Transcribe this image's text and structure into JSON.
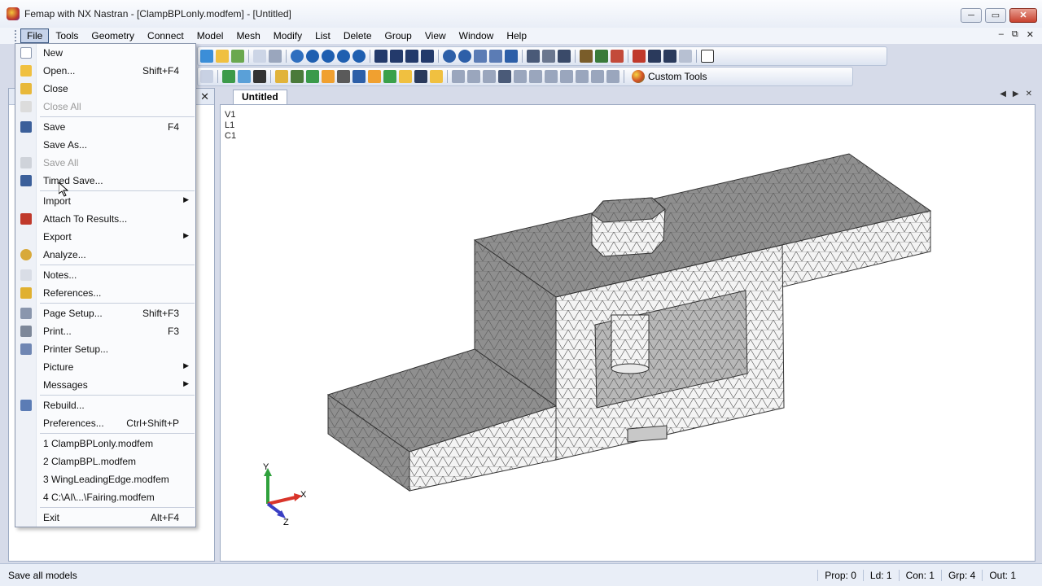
{
  "window": {
    "title": "Femap with NX Nastran - [ClampBPLonly.modfem] - [Untitled]",
    "minimize_label": "─",
    "maximize_label": "▭",
    "close_label": "✕"
  },
  "menubar": {
    "items": [
      "File",
      "Tools",
      "Geometry",
      "Connect",
      "Model",
      "Mesh",
      "Modify",
      "List",
      "Delete",
      "Group",
      "View",
      "Window",
      "Help"
    ],
    "mdi": [
      "–",
      "⧉",
      "✕"
    ]
  },
  "toolbar": {
    "custom_tools_label": "Custom Tools"
  },
  "left_pane": {
    "close_label": "✕"
  },
  "graphics": {
    "tab_label": "Untitled",
    "tab_nav": [
      "◀",
      "▶",
      "✕"
    ],
    "view_info": [
      "V1",
      "L1",
      "C1"
    ],
    "triad": {
      "x_label": "X",
      "y_label": "Y",
      "z_label": "Z"
    }
  },
  "file_menu": {
    "items": [
      {
        "label": "New",
        "shortcut": "",
        "icon": "new-icon",
        "disabled": false
      },
      {
        "label": "Open...",
        "shortcut": "Shift+F4",
        "icon": "open-icon",
        "disabled": false
      },
      {
        "label": "Close",
        "shortcut": "",
        "icon": "close-folder-icon",
        "disabled": false
      },
      {
        "label": "Close All",
        "shortcut": "",
        "icon": "close-all-icon",
        "disabled": true
      },
      {
        "label": "Save",
        "shortcut": "F4",
        "icon": "save-icon",
        "disabled": false
      },
      {
        "label": "Save As...",
        "shortcut": "",
        "icon": "",
        "disabled": false
      },
      {
        "label": "Save All",
        "shortcut": "",
        "icon": "save-all-icon",
        "disabled": true
      },
      {
        "label": "Timed Save...",
        "shortcut": "",
        "icon": "timed-save-icon",
        "disabled": false
      },
      {
        "label": "Import",
        "shortcut": "",
        "icon": "",
        "disabled": false,
        "submenu": true
      },
      {
        "label": "Attach To Results...",
        "shortcut": "",
        "icon": "attach-results-icon",
        "disabled": false
      },
      {
        "label": "Export",
        "shortcut": "",
        "icon": "",
        "disabled": false,
        "submenu": true
      },
      {
        "label": "Analyze...",
        "shortcut": "",
        "icon": "analyze-icon",
        "disabled": false
      },
      {
        "label": "Notes...",
        "shortcut": "",
        "icon": "notes-icon",
        "disabled": false
      },
      {
        "label": "References...",
        "shortcut": "",
        "icon": "references-icon",
        "disabled": false
      },
      {
        "label": "Page Setup...",
        "shortcut": "Shift+F3",
        "icon": "page-setup-icon",
        "disabled": false
      },
      {
        "label": "Print...",
        "shortcut": "F3",
        "icon": "print-icon",
        "disabled": false
      },
      {
        "label": "Printer Setup...",
        "shortcut": "",
        "icon": "printer-setup-icon",
        "disabled": false
      },
      {
        "label": "Picture",
        "shortcut": "",
        "icon": "",
        "disabled": false,
        "submenu": true
      },
      {
        "label": "Messages",
        "shortcut": "",
        "icon": "",
        "disabled": false,
        "submenu": true
      },
      {
        "label": "Rebuild...",
        "shortcut": "",
        "icon": "rebuild-icon",
        "disabled": false
      },
      {
        "label": "Preferences...",
        "shortcut": "Ctrl+Shift+P",
        "icon": "",
        "disabled": false
      },
      {
        "label": "1 ClampBPLonly.modfem",
        "shortcut": "",
        "icon": "",
        "disabled": false
      },
      {
        "label": "2 ClampBPL.modfem",
        "shortcut": "",
        "icon": "",
        "disabled": false
      },
      {
        "label": "3 WingLeadingEdge.modfem",
        "shortcut": "",
        "icon": "",
        "disabled": false
      },
      {
        "label": "4 C:\\AI\\...\\Fairing.modfem",
        "shortcut": "",
        "icon": "",
        "disabled": false
      },
      {
        "label": "Exit",
        "shortcut": "Alt+F4",
        "icon": "",
        "disabled": false
      }
    ]
  },
  "statusbar": {
    "message": "Save all models",
    "fields": [
      "Prop: 0",
      "Ld: 1",
      "Con: 1",
      "Grp: 4",
      "Out: 1"
    ]
  }
}
